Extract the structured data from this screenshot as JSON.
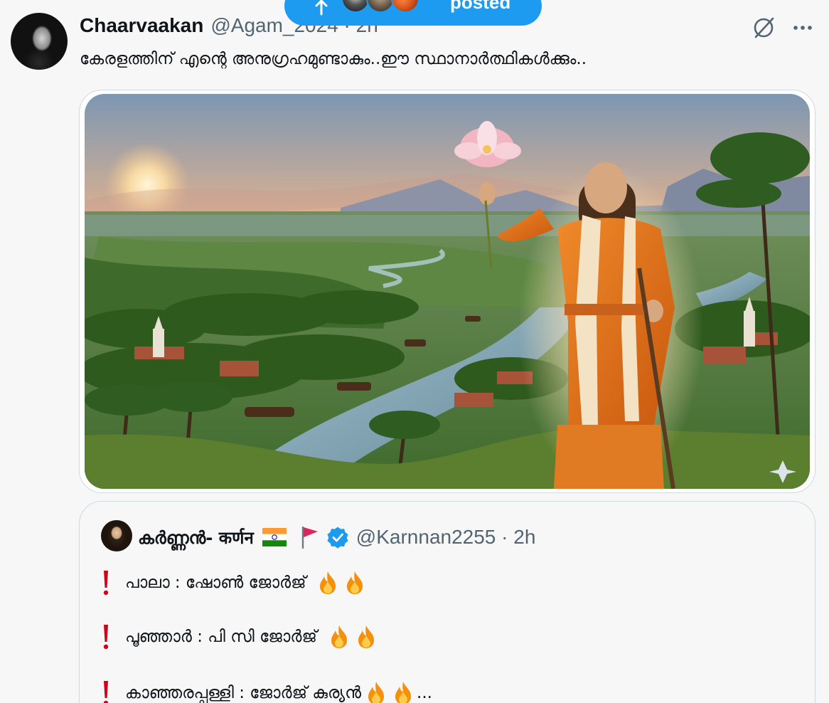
{
  "new_posts_pill": {
    "label": "posted",
    "icon": "arrow-up-icon"
  },
  "tweet": {
    "display_name": "Chaarvaakan",
    "handle_time": "@Agam_2024 · 2h",
    "text": "കേരളത്തിന് എന്റെ അനുഗ്രഹമുണ്ടാകും..ഈ സ്ഥാനാർത്ഥികൾക്കും..",
    "icons": [
      "grok-icon",
      "more-icon"
    ]
  },
  "quoted_post": {
    "display_name": "കർണ്ണൻ- कर्णन",
    "handle_time": "@Karnnan2255 · 2h",
    "badges": [
      "india-flag-icon",
      "red-flag-icon",
      "verified-badge-icon"
    ],
    "lines": [
      {
        "text": "പാലാ : ഷോൺ ജോർജ്",
        "fire_count": 2,
        "ellipsis": ""
      },
      {
        "text": "പൂഞ്ഞാർ : പി സി ജോർജ്",
        "fire_count": 2,
        "ellipsis": ""
      },
      {
        "text": "കാഞ്ഞരപ്പള്ളി : ജോർജ് കുര്യൻ",
        "fire_count": 2,
        "ellipsis": "..."
      }
    ]
  },
  "colors": {
    "accent": "#1d9bf0",
    "text_primary": "#0f1419",
    "text_secondary": "#536471",
    "border": "#cfd9de",
    "background": "#f7f7f8"
  }
}
